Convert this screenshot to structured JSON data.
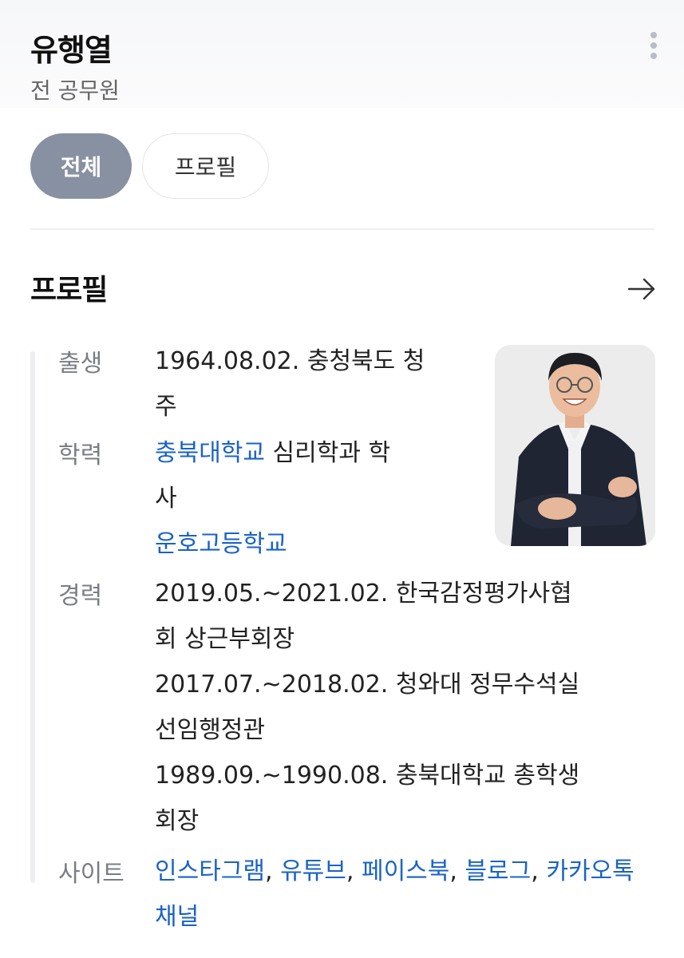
{
  "header": {
    "name": "유행열",
    "subtitle": "전 공무원"
  },
  "tabs": [
    {
      "label": "전체",
      "selected": true
    },
    {
      "label": "프로필",
      "selected": false
    }
  ],
  "profile": {
    "title": "프로필",
    "birth": {
      "label": "출생",
      "line1": "1964.08.02. 충청북도 청",
      "line2": "주"
    },
    "education": {
      "label": "학력",
      "school1_link": "충북대학교",
      "school1_rest_line1": " 심리학과 학",
      "school1_rest_line2": "사",
      "school2_link": "운호고등학교"
    },
    "career": {
      "label": "경력",
      "items": [
        {
          "line1": "2019.05.~2021.02. 한국감정평가사협",
          "line2": "회 상근부회장"
        },
        {
          "line1": "2017.07.~2018.02. 청와대 정무수석실",
          "line2": "선임행정관"
        },
        {
          "line1": "1989.09.~1990.08. 충북대학교 총학생",
          "line2": "회장"
        }
      ]
    },
    "sites": {
      "label": "사이트",
      "links": [
        "인스타그램",
        "유튜브",
        "페이스북",
        "블로그",
        "카카오톡채널"
      ],
      "separator": ", "
    }
  },
  "colors": {
    "accent_link": "#1a63c5",
    "tab_selected_bg": "#8791a2"
  },
  "icons": {
    "more": "more-vertical-icon",
    "arrow": "arrow-right-icon"
  }
}
